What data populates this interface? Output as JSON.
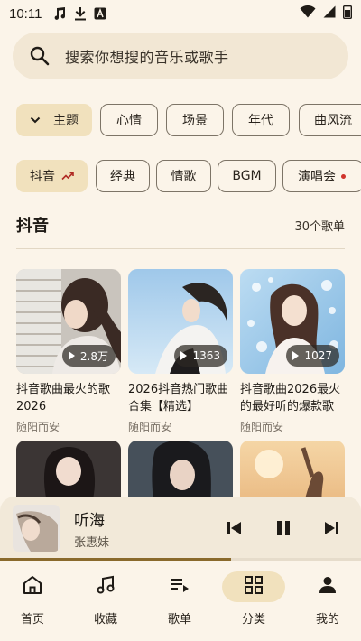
{
  "status_bar": {
    "time": "10:11",
    "icons": [
      "music-note-icon",
      "download-icon",
      "font-a-icon",
      "wifi-icon",
      "signal-icon",
      "battery-icon"
    ]
  },
  "search": {
    "placeholder": "搜索你想搜的音乐或歌手"
  },
  "filter_row_1": {
    "chips": [
      {
        "label": "主题",
        "selected": true,
        "icon": "chevron-down-icon"
      },
      {
        "label": "心情",
        "selected": false
      },
      {
        "label": "场景",
        "selected": false
      },
      {
        "label": "年代",
        "selected": false
      },
      {
        "label": "曲风流",
        "selected": false
      }
    ]
  },
  "filter_row_2": {
    "chips": [
      {
        "label": "抖音",
        "selected": true,
        "icon": "trending-icon"
      },
      {
        "label": "经典",
        "selected": false
      },
      {
        "label": "情歌",
        "selected": false
      },
      {
        "label": "BGM",
        "selected": false
      },
      {
        "label": "演唱会",
        "selected": false,
        "badge": "red-dot"
      }
    ]
  },
  "section": {
    "title": "抖音",
    "count": "30个歌单"
  },
  "playlists": [
    {
      "title": "抖音歌曲最火的歌2026",
      "author": "随阳而安",
      "plays": "2.8万"
    },
    {
      "title": "2026抖音热门歌曲合集【精选】",
      "author": "随阳而安",
      "plays": "1363"
    },
    {
      "title": "抖音歌曲2026最火的最好听的爆款歌",
      "author": "随阳而安",
      "plays": "1027"
    }
  ],
  "player": {
    "song": "听海",
    "artist": "张惠妹",
    "progress": 0.64
  },
  "nav": {
    "items": [
      {
        "label": "首页",
        "icon": "home-icon",
        "active": false
      },
      {
        "label": "收藏",
        "icon": "music-note-icon",
        "active": false
      },
      {
        "label": "歌单",
        "icon": "playlist-icon",
        "active": false
      },
      {
        "label": "分类",
        "icon": "grid-icon",
        "active": true
      },
      {
        "label": "我的",
        "icon": "person-icon",
        "active": false
      }
    ]
  },
  "colors": {
    "background": "#fbf4e9",
    "selected_chip": "#f1e1bd",
    "accent": "#8a6a2c",
    "notification_dot": "#d0342c"
  }
}
